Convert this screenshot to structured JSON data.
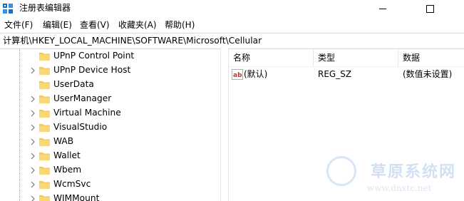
{
  "window": {
    "title": "注册表编辑器",
    "icons": {
      "app": "registry-editor-icon",
      "minimize": "minimize-icon",
      "maximize": "maximize-icon"
    }
  },
  "menu": {
    "items": [
      {
        "label": "文件(F)"
      },
      {
        "label": "编辑(E)"
      },
      {
        "label": "查看(V)"
      },
      {
        "label": "收藏夹(A)"
      },
      {
        "label": "帮助(H)"
      }
    ]
  },
  "address": {
    "path": "计算机\\HKEY_LOCAL_MACHINE\\SOFTWARE\\Microsoft\\Cellular"
  },
  "tree": {
    "items": [
      {
        "label": "UPnP Control Point",
        "expandable": false
      },
      {
        "label": "UPnP Device Host",
        "expandable": true
      },
      {
        "label": "UserData",
        "expandable": false
      },
      {
        "label": "UserManager",
        "expandable": true
      },
      {
        "label": "Virtual Machine",
        "expandable": true
      },
      {
        "label": "VisualStudio",
        "expandable": true
      },
      {
        "label": "WAB",
        "expandable": true
      },
      {
        "label": "Wallet",
        "expandable": true
      },
      {
        "label": "Wbem",
        "expandable": true
      },
      {
        "label": "WcmSvc",
        "expandable": true
      },
      {
        "label": "WIMMount",
        "expandable": true
      }
    ]
  },
  "list": {
    "columns": [
      "名称",
      "类型",
      "数据"
    ],
    "rows": [
      {
        "name": "(默认)",
        "type": "REG_SZ",
        "data": "(数值未设置)",
        "icon": "string-value-icon"
      }
    ]
  },
  "watermark": {
    "text": "草原系统网",
    "url": "www.dnxtc.net"
  },
  "colors": {
    "folder": "#f4c65a",
    "folder_dark": "#e2a83a",
    "value_icon_red": "#c0392b",
    "watermark_blue": "#7fa8db"
  }
}
